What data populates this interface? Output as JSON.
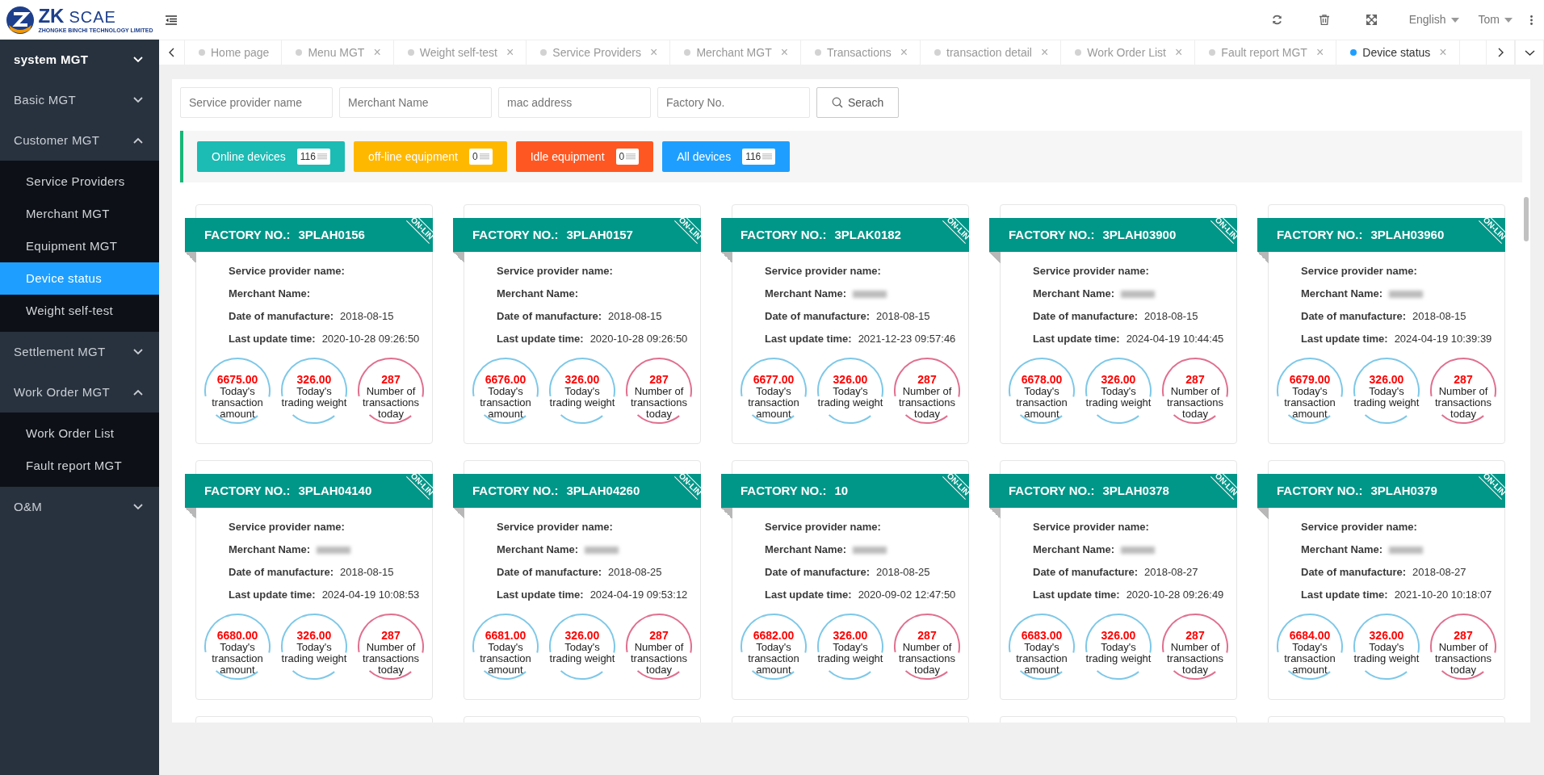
{
  "logo": {
    "mark": "ZK",
    "name": "SCAE",
    "subtitle": "ZHONGKE BINCHI TECHNOLOGY LIMITED"
  },
  "header": {
    "language": "English",
    "user": "Tom"
  },
  "sidebar": {
    "items": [
      {
        "label": "system MGT",
        "selected": true,
        "expanded": false
      },
      {
        "label": "Basic MGT",
        "selected": false,
        "expanded": false
      },
      {
        "label": "Customer MGT",
        "selected": false,
        "expanded": true,
        "children": [
          {
            "label": "Service Providers",
            "selected": false
          },
          {
            "label": "Merchant MGT",
            "selected": false
          },
          {
            "label": "Equipment MGT",
            "selected": false
          },
          {
            "label": "Device status",
            "selected": true
          },
          {
            "label": "Weight self-test",
            "selected": false
          }
        ]
      },
      {
        "label": "Settlement MGT",
        "selected": false,
        "expanded": false
      },
      {
        "label": "Work Order MGT",
        "selected": false,
        "expanded": true,
        "children": [
          {
            "label": "Work Order List",
            "selected": false
          },
          {
            "label": "Fault report MGT",
            "selected": false
          }
        ]
      },
      {
        "label": "O&M",
        "selected": false,
        "expanded": false
      }
    ]
  },
  "tabs": [
    {
      "label": "Home page",
      "selected": false
    },
    {
      "label": "Menu MGT",
      "selected": false,
      "close": "×"
    },
    {
      "label": "Weight self-test",
      "selected": false,
      "close": "×"
    },
    {
      "label": "Service Providers",
      "selected": false,
      "close": "×"
    },
    {
      "label": "Merchant MGT",
      "selected": false,
      "close": "×"
    },
    {
      "label": "Transactions",
      "selected": false,
      "close": "×"
    },
    {
      "label": "transaction detail",
      "selected": false,
      "close": "×"
    },
    {
      "label": "Work Order List",
      "selected": false,
      "close": "×"
    },
    {
      "label": "Fault report MGT",
      "selected": false,
      "close": "×"
    },
    {
      "label": "Device status",
      "selected": true,
      "close": "×"
    }
  ],
  "filters": {
    "fields": [
      {
        "placeholder": "Service provider name"
      },
      {
        "placeholder": "Merchant Name"
      },
      {
        "placeholder": "mac address"
      },
      {
        "placeholder": "Factory No."
      }
    ],
    "search_button": "Serach"
  },
  "status_buttons": [
    {
      "label": "Online devices",
      "count": "116",
      "color": "#1cbbb4"
    },
    {
      "label": "off-line equipment",
      "count": "0",
      "color": "#ffb800"
    },
    {
      "label": "Idle equipment",
      "count": "0",
      "color": "#ff5722"
    },
    {
      "label": "All devices",
      "count": "116",
      "color": "#1e9fff"
    }
  ],
  "cards": [
    {
      "kind": "device",
      "title": "FACTORY NO.:",
      "factory_no": "3PLAH0156",
      "status": "ON-LIN",
      "fields": [
        {
          "label": "Service provider name:",
          "blurred": false
        },
        {
          "label": "Merchant Name:",
          "blurred": false
        },
        {
          "label": "Date of manufacture:",
          "value": "2018-08-15",
          "blurred": false
        },
        {
          "label": "Last update time:",
          "value": "2020-10-28 09:26:50",
          "blurred": false
        }
      ],
      "stats": [
        {
          "value": "6675.00",
          "label": "Today's transaction amount",
          "color": "#7ec8e8"
        },
        {
          "value": "326.00",
          "label": "Today's trading weight",
          "color": "#7ec8e8"
        },
        {
          "value": "287",
          "label": "Number of transactions today",
          "color": "#e0708f"
        }
      ]
    },
    {
      "kind": "device",
      "title": "FACTORY NO.:",
      "factory_no": "3PLAH0157",
      "status": "ON-LIN",
      "fields": [
        {
          "label": "Service provider name:",
          "blurred": false
        },
        {
          "label": "Merchant Name:",
          "blurred": false
        },
        {
          "label": "Date of manufacture:",
          "value": "2018-08-15",
          "blurred": false
        },
        {
          "label": "Last update time:",
          "value": "2020-10-28 09:26:50",
          "blurred": false
        }
      ],
      "stats": [
        {
          "value": "6676.00",
          "label": "Today's transaction amount",
          "color": "#7ec8e8"
        },
        {
          "value": "326.00",
          "label": "Today's trading weight",
          "color": "#7ec8e8"
        },
        {
          "value": "287",
          "label": "Number of transactions today",
          "color": "#e0708f"
        }
      ]
    },
    {
      "kind": "device",
      "title": "FACTORY NO.:",
      "factory_no": "3PLAK0182",
      "status": "ON-LIN",
      "fields": [
        {
          "label": "Service provider name:",
          "blurred": false
        },
        {
          "label": "Merchant Name:",
          "blurred": true
        },
        {
          "label": "Date of manufacture:",
          "value": "2018-08-15",
          "blurred": false
        },
        {
          "label": "Last update time:",
          "value": "2021-12-23 09:57:46",
          "blurred": false
        }
      ],
      "stats": [
        {
          "value": "6677.00",
          "label": "Today's transaction amount",
          "color": "#7ec8e8"
        },
        {
          "value": "326.00",
          "label": "Today's trading weight",
          "color": "#7ec8e8"
        },
        {
          "value": "287",
          "label": "Number of transactions today",
          "color": "#e0708f"
        }
      ]
    },
    {
      "kind": "device",
      "title": "FACTORY NO.:",
      "factory_no": "3PLAH03900",
      "status": "ON-LIN",
      "fields": [
        {
          "label": "Service provider name:",
          "blurred": false
        },
        {
          "label": "Merchant Name:",
          "blurred": true
        },
        {
          "label": "Date of manufacture:",
          "value": "2018-08-15",
          "blurred": false
        },
        {
          "label": "Last update time:",
          "value": "2024-04-19 10:44:45",
          "blurred": false
        }
      ],
      "stats": [
        {
          "value": "6678.00",
          "label": "Today's transaction amount",
          "color": "#7ec8e8"
        },
        {
          "value": "326.00",
          "label": "Today's trading weight",
          "color": "#7ec8e8"
        },
        {
          "value": "287",
          "label": "Number of transactions today",
          "color": "#e0708f"
        }
      ]
    },
    {
      "kind": "device",
      "title": "FACTORY NO.:",
      "factory_no": "3PLAH03960",
      "status": "ON-LIN",
      "fields": [
        {
          "label": "Service provider name:",
          "blurred": false
        },
        {
          "label": "Merchant Name:",
          "blurred": true
        },
        {
          "label": "Date of manufacture:",
          "value": "2018-08-15",
          "blurred": false
        },
        {
          "label": "Last update time:",
          "value": "2024-04-19 10:39:39",
          "blurred": false
        }
      ],
      "stats": [
        {
          "value": "6679.00",
          "label": "Today's transaction amount",
          "color": "#7ec8e8"
        },
        {
          "value": "326.00",
          "label": "Today's trading weight",
          "color": "#7ec8e8"
        },
        {
          "value": "287",
          "label": "Number of transactions today",
          "color": "#e0708f"
        }
      ]
    },
    {
      "kind": "device",
      "title": "FACTORY NO.:",
      "factory_no": "3PLAH04140",
      "status": "ON-LIN",
      "fields": [
        {
          "label": "Service provider name:",
          "blurred": false
        },
        {
          "label": "Merchant Name:",
          "blurred": true
        },
        {
          "label": "Date of manufacture:",
          "value": "2018-08-15",
          "blurred": false
        },
        {
          "label": "Last update time:",
          "value": "2024-04-19 10:08:53",
          "blurred": false
        }
      ],
      "stats": [
        {
          "value": "6680.00",
          "label": "Today's transaction amount",
          "color": "#7ec8e8"
        },
        {
          "value": "326.00",
          "label": "Today's trading weight",
          "color": "#7ec8e8"
        },
        {
          "value": "287",
          "label": "Number of transactions today",
          "color": "#e0708f"
        }
      ]
    },
    {
      "kind": "device",
      "title": "FACTORY NO.:",
      "factory_no": "3PLAH04260",
      "status": "ON-LIN",
      "fields": [
        {
          "label": "Service provider name:",
          "blurred": false
        },
        {
          "label": "Merchant Name:",
          "blurred": true
        },
        {
          "label": "Date of manufacture:",
          "value": "2018-08-25",
          "blurred": false
        },
        {
          "label": "Last update time:",
          "value": "2024-04-19 09:53:12",
          "blurred": false
        }
      ],
      "stats": [
        {
          "value": "6681.00",
          "label": "Today's transaction amount",
          "color": "#7ec8e8"
        },
        {
          "value": "326.00",
          "label": "Today's trading weight",
          "color": "#7ec8e8"
        },
        {
          "value": "287",
          "label": "Number of transactions today",
          "color": "#e0708f"
        }
      ]
    },
    {
      "kind": "device",
      "title": "FACTORY NO.:",
      "factory_no": "10",
      "status": "ON-LIN",
      "fields": [
        {
          "label": "Service provider name:",
          "blurred": false
        },
        {
          "label": "Merchant Name:",
          "blurred": true
        },
        {
          "label": "Date of manufacture:",
          "value": "2018-08-25",
          "blurred": false
        },
        {
          "label": "Last update time:",
          "value": "2020-09-02 12:47:50",
          "blurred": false
        }
      ],
      "stats": [
        {
          "value": "6682.00",
          "label": "Today's transaction amount",
          "color": "#7ec8e8"
        },
        {
          "value": "326.00",
          "label": "Today's trading weight",
          "color": "#7ec8e8"
        },
        {
          "value": "287",
          "label": "Number of transactions today",
          "color": "#e0708f"
        }
      ]
    },
    {
      "kind": "device",
      "title": "FACTORY NO.:",
      "factory_no": "3PLAH0378",
      "status": "ON-LIN",
      "fields": [
        {
          "label": "Service provider name:",
          "blurred": false
        },
        {
          "label": "Merchant Name:",
          "blurred": true
        },
        {
          "label": "Date of manufacture:",
          "value": "2018-08-27",
          "blurred": false
        },
        {
          "label": "Last update time:",
          "value": "2020-10-28 09:26:49",
          "blurred": false
        }
      ],
      "stats": [
        {
          "value": "6683.00",
          "label": "Today's transaction amount",
          "color": "#7ec8e8"
        },
        {
          "value": "326.00",
          "label": "Today's trading weight",
          "color": "#7ec8e8"
        },
        {
          "value": "287",
          "label": "Number of transactions today",
          "color": "#e0708f"
        }
      ]
    },
    {
      "kind": "device",
      "title": "FACTORY NO.:",
      "factory_no": "3PLAH0379",
      "status": "ON-LIN",
      "fields": [
        {
          "label": "Service provider name:",
          "blurred": false
        },
        {
          "label": "Merchant Name:",
          "blurred": true
        },
        {
          "label": "Date of manufacture:",
          "value": "2018-08-27",
          "blurred": false
        },
        {
          "label": "Last update time:",
          "value": "2021-10-20 10:18:07",
          "blurred": false
        }
      ],
      "stats": [
        {
          "value": "6684.00",
          "label": "Today's transaction amount",
          "color": "#7ec8e8"
        },
        {
          "value": "326.00",
          "label": "Today's trading weight",
          "color": "#7ec8e8"
        },
        {
          "value": "287",
          "label": "Number of transactions today",
          "color": "#e0708f"
        }
      ]
    },
    {
      "kind": "clipped"
    },
    {
      "kind": "clipped"
    },
    {
      "kind": "clipped"
    },
    {
      "kind": "clipped"
    },
    {
      "kind": "clipped"
    }
  ]
}
